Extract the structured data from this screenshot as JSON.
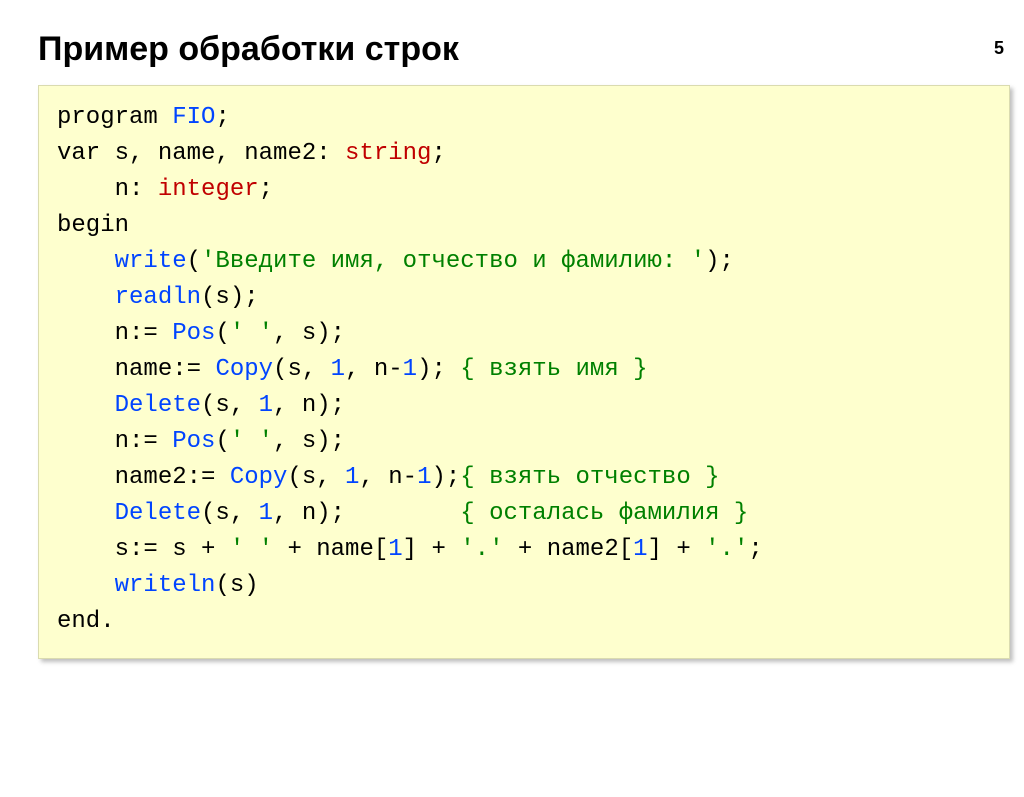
{
  "page_number": "5",
  "title": "Пример обработки строк",
  "code": {
    "l01": {
      "kw_program": "program ",
      "id_fio": "FIO",
      "semi": ";"
    },
    "l02": {
      "kw_var": "var ",
      "txt": "s, name, name2: ",
      "type": "string",
      "semi": ";"
    },
    "l03": {
      "pad": "    ",
      "txt": "n: ",
      "type": "integer",
      "semi": ";"
    },
    "l04": {
      "kw_begin": "begin"
    },
    "l05": {
      "pad": "    ",
      "fn": "write",
      "open": "(",
      "str": "'Введите имя, отчество и фамилию: '",
      "close": ");"
    },
    "l06": {
      "pad": "    ",
      "fn": "readln",
      "txt": "(s);"
    },
    "l07": {
      "pad": "    ",
      "lhs": "n:= ",
      "fn": "Pos",
      "open": "(",
      "str": "' '",
      "rest": ", s);"
    },
    "l08": {
      "pad": "    ",
      "lhs": "name:= ",
      "fn": "Copy",
      "open": "(s, ",
      "num1": "1",
      "mid": ", n-",
      "num2": "1",
      "close": "); ",
      "cmt": "{ взять имя }"
    },
    "l09": {
      "pad": "    ",
      "fn": "Delete",
      "open": "(s, ",
      "num1": "1",
      "rest": ", n);"
    },
    "l10": {
      "pad": "    ",
      "lhs": "n:= ",
      "fn": "Pos",
      "open": "(",
      "str": "' '",
      "rest": ", s);"
    },
    "l11": {
      "pad": "    ",
      "lhs": "name2:= ",
      "fn": "Copy",
      "open": "(s, ",
      "num1": "1",
      "mid": ", n-",
      "num2": "1",
      "close": ");",
      "cmt": "{ взять отчество }"
    },
    "l12": {
      "pad": "    ",
      "fn": "Delete",
      "open": "(s, ",
      "num1": "1",
      "rest": ", n);        ",
      "cmt": "{ осталась фамилия }"
    },
    "l13": {
      "pad": "    ",
      "a": "s:= s + ",
      "s1": "' '",
      "b": " + name[",
      "n1": "1",
      "c": "] + ",
      "s2": "'.'",
      "d": " + name2[",
      "n2": "1",
      "e": "] + ",
      "s3": "'.'",
      "f": ";"
    },
    "l14": {
      "pad": "    ",
      "fn": "writeln",
      "txt": "(s)"
    },
    "l15": {
      "kw_end": "end."
    }
  }
}
